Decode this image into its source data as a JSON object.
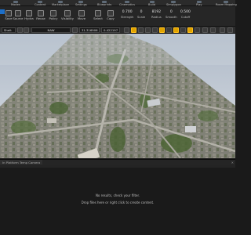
{
  "menu": {
    "items": [
      "Modes",
      "Content",
      "Marketplace",
      "Settings",
      "Blueprints",
      "Cinematics",
      "Build",
      "Simplygon",
      "Play",
      "Room Mapping"
    ]
  },
  "tools": {
    "items": [
      {
        "label": "Save",
        "icon": "save-icon"
      },
      {
        "label": "Source",
        "icon": "source-control-icon"
      },
      {
        "label": "Hydra",
        "icon": "hydra-icon"
      },
      {
        "label": "Reuse",
        "icon": "reuse-icon"
      },
      {
        "label": "Policy",
        "icon": "policy-icon"
      },
      {
        "label": "Visibility",
        "icon": "visibility-icon"
      },
      {
        "label": "Move",
        "icon": "move-icon"
      },
      {
        "label": "Select",
        "icon": "select-icon"
      },
      {
        "label": "Copy",
        "icon": "copy-icon"
      }
    ],
    "stats": [
      {
        "value": "0.700",
        "label": "Strength"
      },
      {
        "value": "0",
        "label": "Scale"
      },
      {
        "value": "8192",
        "label": "Radius"
      },
      {
        "value": "0",
        "label": "Smooth"
      },
      {
        "value": "0.500",
        "label": "Cutoff"
      }
    ]
  },
  "viewport_bar": {
    "mode": "Shelt",
    "search": "NAW",
    "coords": "31.316906",
    "scale": "0.422197"
  },
  "panel": {
    "tab_label": "In Platform Temp Camera",
    "empty_line1": "No results, check your filter.",
    "empty_line2": "Drop files here or right click to create content."
  },
  "colors": {
    "accent": "#e0a300",
    "selection": "#1d6fc9"
  }
}
